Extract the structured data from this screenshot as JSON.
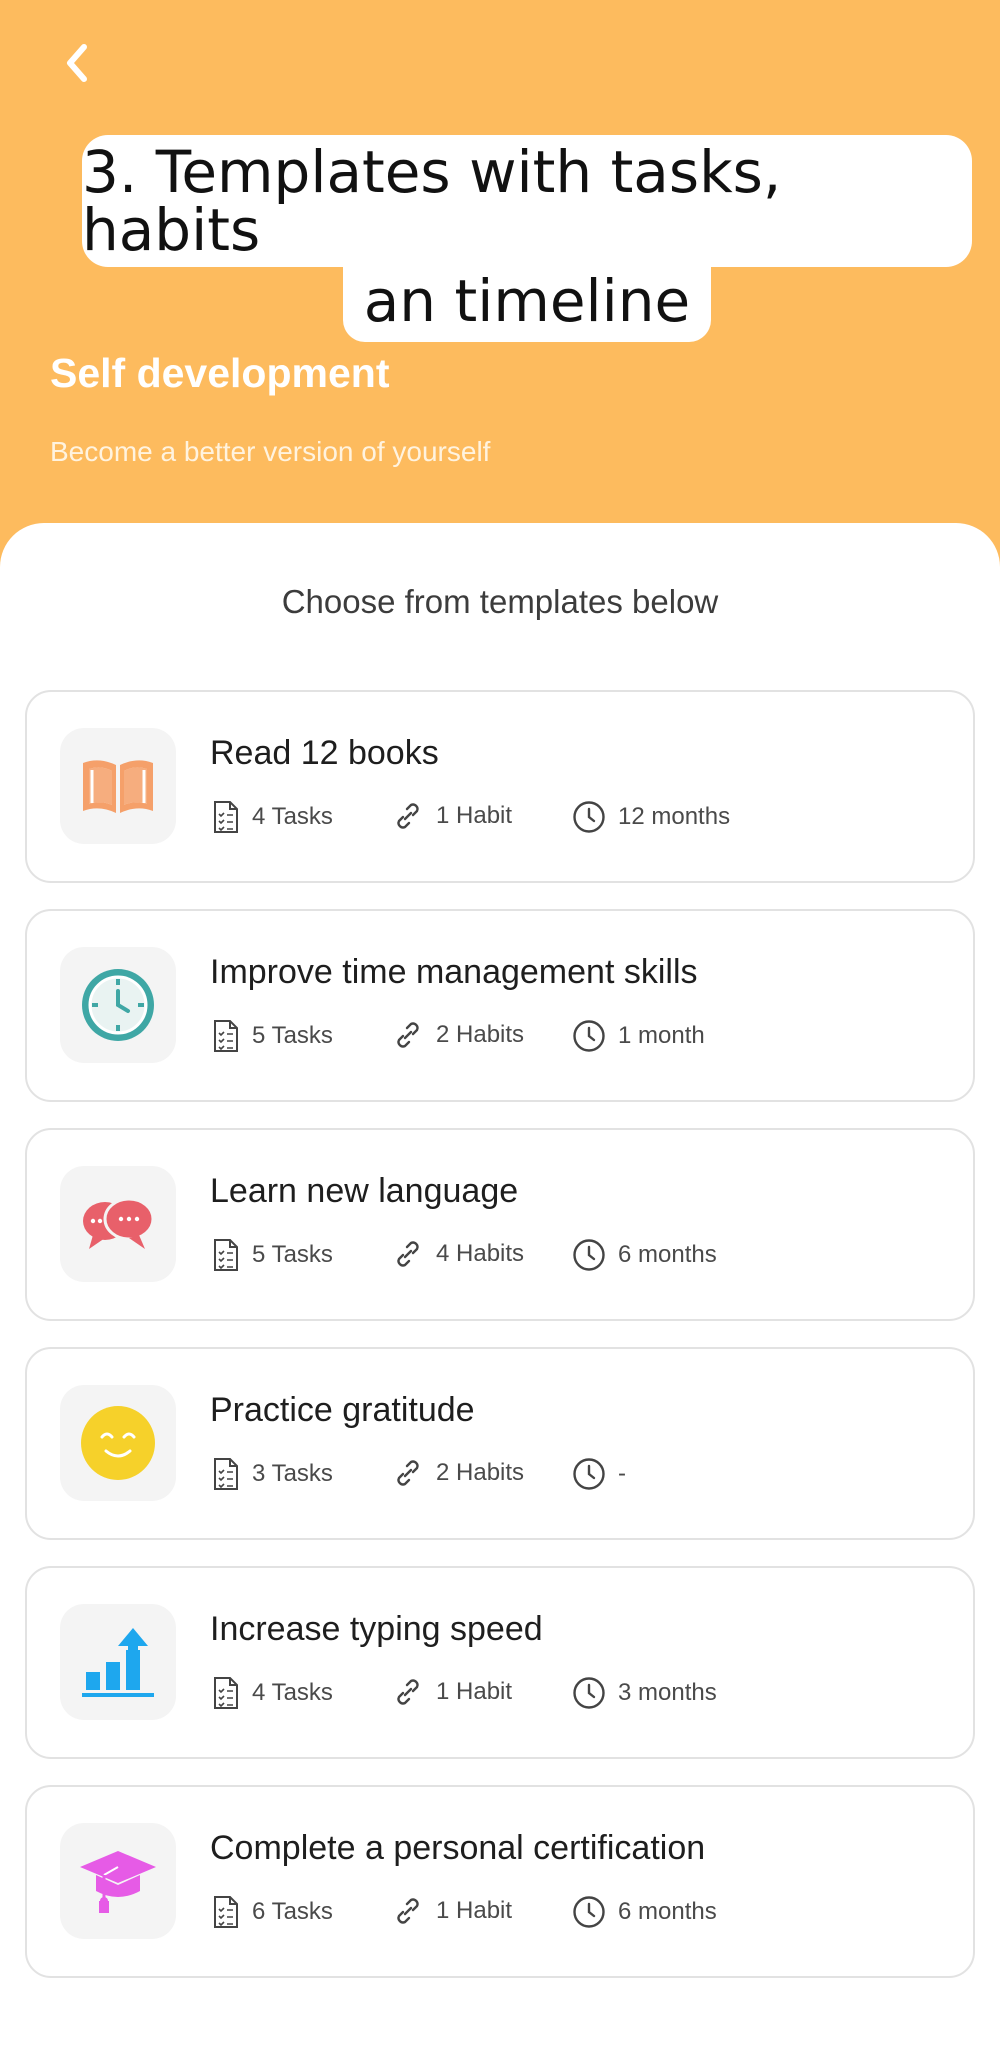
{
  "caption": {
    "line1": "3. Templates with tasks, habits",
    "line2": "an timeline"
  },
  "hero": {
    "title": "Self development",
    "subtitle": "Become a better version of yourself"
  },
  "section_title": "Choose from templates below",
  "templates": [
    {
      "title": "Read 12 books",
      "tasks": "4 Tasks",
      "habits": "1 Habit",
      "duration": "12 months",
      "icon": "open-book-icon"
    },
    {
      "title": "Improve time management skills",
      "tasks": "5 Tasks",
      "habits": "2 Habits",
      "duration": "1 month",
      "icon": "clock-icon"
    },
    {
      "title": "Learn new language",
      "tasks": "5 Tasks",
      "habits": "4 Habits",
      "duration": "6 months",
      "icon": "speech-bubbles-icon"
    },
    {
      "title": "Practice gratitude",
      "tasks": "3 Tasks",
      "habits": "2 Habits",
      "duration": "-",
      "icon": "smiley-icon"
    },
    {
      "title": "Increase typing speed",
      "tasks": "4 Tasks",
      "habits": "1 Habit",
      "duration": "3 months",
      "icon": "growth-chart-icon"
    },
    {
      "title": "Complete a personal certification",
      "tasks": "6 Tasks",
      "habits": "1 Habit",
      "duration": "6 months",
      "icon": "graduation-cap-icon"
    }
  ],
  "colors": {
    "header_bg": "#fdbb5e",
    "book": "#f5a06a",
    "clock": "#3fa7a5",
    "bubbles": "#e8606a",
    "smiley": "#f6d12a",
    "chart": "#1ea7ee",
    "cap": "#e65be6"
  }
}
